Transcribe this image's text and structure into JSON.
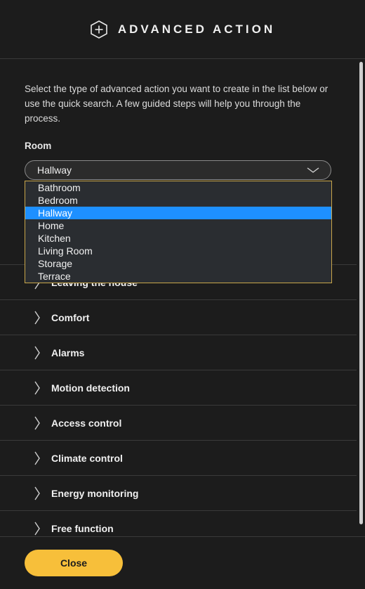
{
  "header": {
    "title": "ADVANCED ACTION",
    "icon": "plus-hexagon-icon"
  },
  "intro": "Select the type of advanced action you want to create in the list below or use the quick search. A few guided steps will help you through the process.",
  "room": {
    "label": "Room",
    "selected": "Hallway",
    "options": [
      "Bathroom",
      "Bedroom",
      "Hallway",
      "Home",
      "Kitchen",
      "Living Room",
      "Storage",
      "Terrace"
    ]
  },
  "categories": [
    "Leaving the house",
    "Comfort",
    "Alarms",
    "Motion detection",
    "Access control",
    "Climate control",
    "Energy monitoring",
    "Free function"
  ],
  "footer": {
    "close_label": "Close"
  },
  "colors": {
    "accent": "#f7bf3a",
    "selection": "#1e90ff",
    "background": "#1c1c1c"
  }
}
